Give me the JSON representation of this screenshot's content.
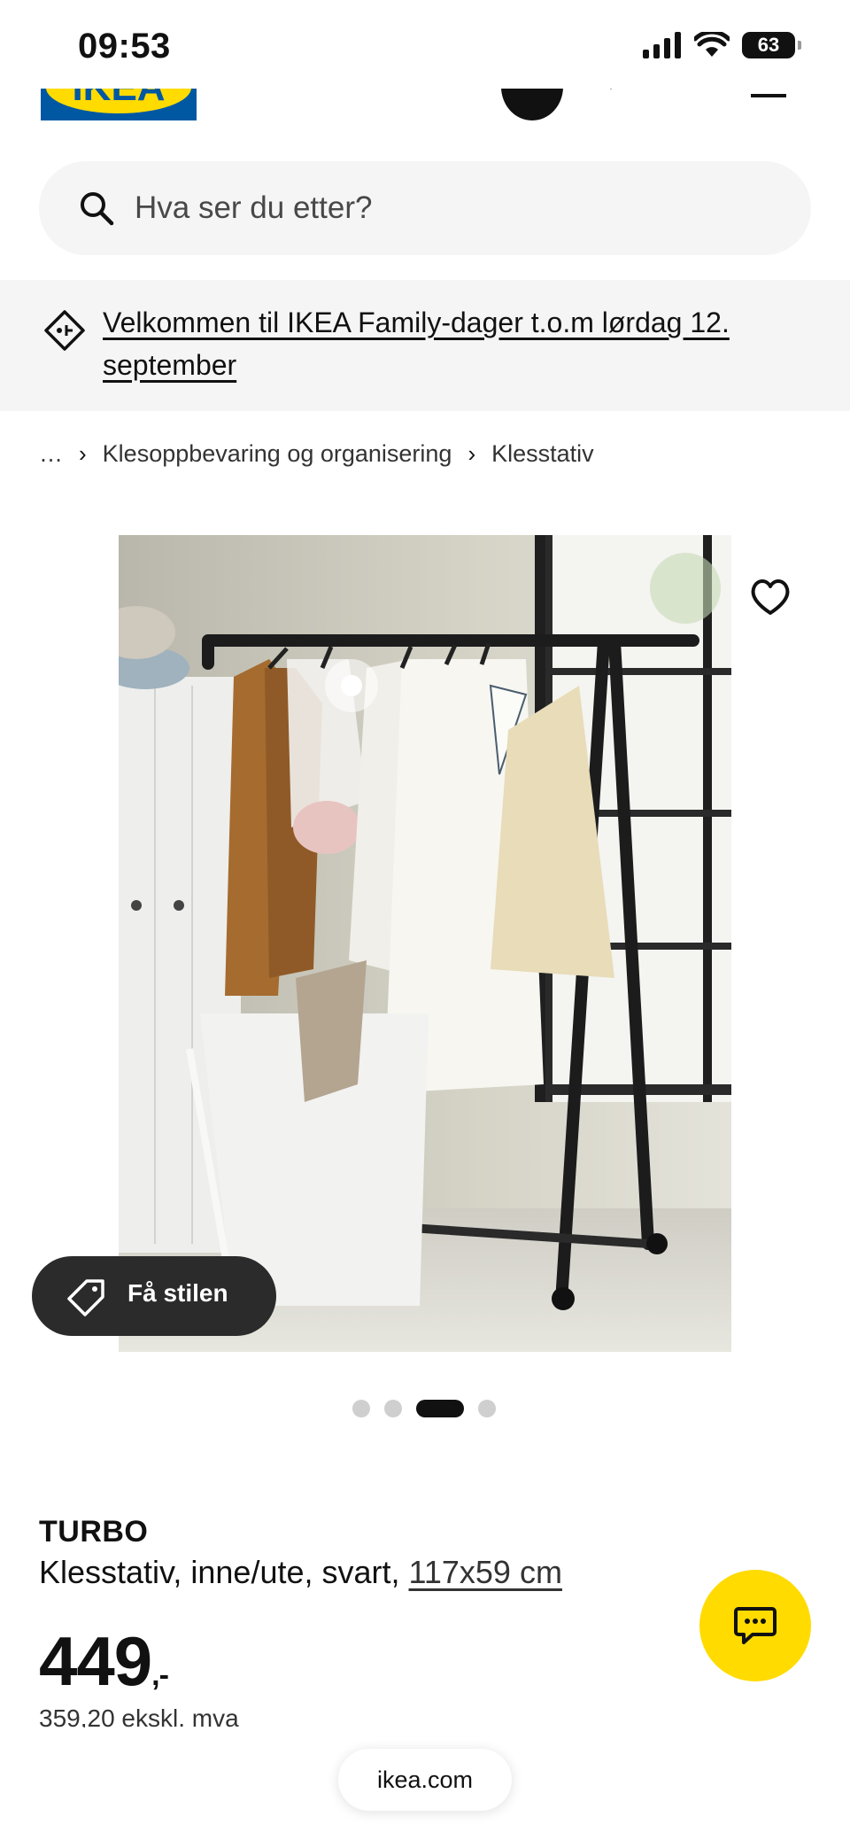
{
  "status_bar": {
    "time": "09:53",
    "battery": "63"
  },
  "header": {
    "logo_text": "IKEA"
  },
  "search": {
    "placeholder": "Hva ser du etter?"
  },
  "promo": {
    "text": "Velkommen til IKEA Family-dager t.o.m lørdag 12. september"
  },
  "breadcrumb": {
    "items": [
      "…",
      "Klesoppbevaring og organisering",
      "Klesstativ"
    ]
  },
  "gallery": {
    "style_button_label": "Få stilen",
    "dots_total": 4,
    "active_dot": 3
  },
  "product": {
    "name": "TURBO",
    "description": "Klesstativ, inne/ute, svart, ",
    "size_link": "117x59 cm",
    "price": "449",
    "price_suffix": ",-",
    "price_ex_vat": "359,20 ekskl. mva"
  },
  "browser": {
    "url": "ikea.com"
  },
  "colors": {
    "ikea_blue": "#0058a3",
    "ikea_yellow": "#ffdb00",
    "banner_bg": "#f5f5f5"
  }
}
